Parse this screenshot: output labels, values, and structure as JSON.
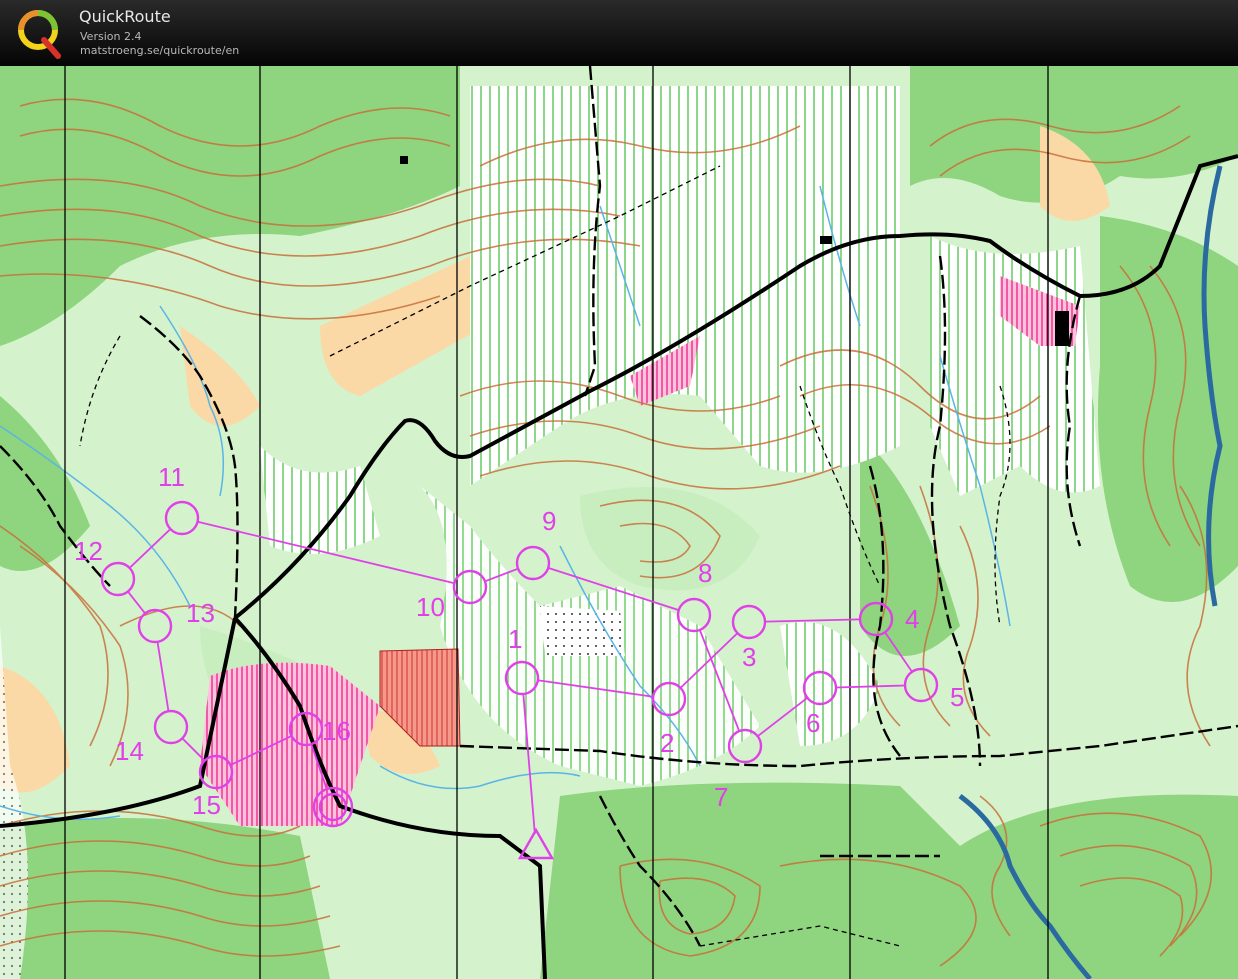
{
  "app": {
    "name": "QuickRoute",
    "version": "Version 2.4",
    "url": "matstroeng.se/quickroute/en"
  },
  "course": {
    "color": "#e040e8",
    "start_label": "start",
    "finish_label": "finish",
    "controls": [
      {
        "number": "1"
      },
      {
        "number": "2"
      },
      {
        "number": "3"
      },
      {
        "number": "4"
      },
      {
        "number": "5"
      },
      {
        "number": "6"
      },
      {
        "number": "7"
      },
      {
        "number": "8"
      },
      {
        "number": "9"
      },
      {
        "number": "10"
      },
      {
        "number": "11"
      },
      {
        "number": "12"
      },
      {
        "number": "13"
      },
      {
        "number": "14"
      },
      {
        "number": "15"
      },
      {
        "number": "16"
      }
    ]
  },
  "map_colors": {
    "open_land": "#ffffff",
    "forest_green": "#8fd47e",
    "light_green": "#c8eec0",
    "rough_open": "#fbd9a6",
    "contour": "#c8703a",
    "water": "#5ab4e6",
    "road": "#000000",
    "course": "#e040e8"
  }
}
